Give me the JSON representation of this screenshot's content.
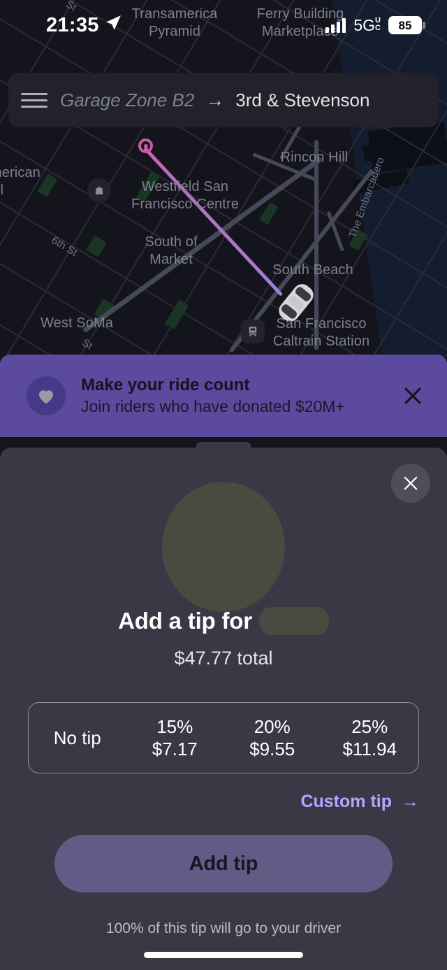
{
  "status_bar": {
    "time": "21:35",
    "location_arrow_icon": "navigation-arrow-icon",
    "signal_icon": "cellular-bars-icon",
    "network": "5G",
    "network_sup_top": "U",
    "network_sup_bottom": "C",
    "battery_level": "85"
  },
  "top_bar": {
    "menu_icon": "hamburger-menu-icon",
    "from": "Garage Zone B2",
    "arrow": "→",
    "to": "3rd & Stevenson"
  },
  "map": {
    "labels": [
      {
        "text": "Transamerica\nPyramid"
      },
      {
        "text": "Ferry Building\nMarketplace"
      },
      {
        "text": "Rincon Hill"
      },
      {
        "text": "Westfield San\nFrancisco Centre"
      },
      {
        "text": "South of\nMarket"
      },
      {
        "text": "South Beach"
      },
      {
        "text": "West SoMa"
      },
      {
        "text": "San Francisco\nCaltrain Station"
      },
      {
        "text": "The Embarcadero"
      },
      {
        "text": "6th St"
      },
      {
        "text": "merican"
      },
      {
        "text": "ll"
      },
      {
        "text": "St"
      },
      {
        "text": "St"
      }
    ],
    "origin_marker": "origin-pin-icon",
    "vehicle_marker": "car-marker-icon",
    "shopping_poi": "shopping-bag-icon",
    "transit_poi": "train-station-icon",
    "route_color": "#c766b0"
  },
  "banner": {
    "icon": "heart-icon",
    "title": "Make your ride count",
    "subtitle": "Join riders who have donated $20M+",
    "close_icon": "close-icon",
    "background": "#5b4a9e"
  },
  "tip_sheet": {
    "close_icon": "close-icon",
    "avatar": "driver-avatar-redacted",
    "title": "Add a tip for",
    "driver_name_redacted": "",
    "total": "$47.77 total",
    "options": [
      {
        "percent": "No tip",
        "amount": ""
      },
      {
        "percent": "15%",
        "amount": "$7.17"
      },
      {
        "percent": "20%",
        "amount": "$9.55"
      },
      {
        "percent": "25%",
        "amount": "$11.94"
      }
    ],
    "custom_tip_label": "Custom tip",
    "custom_tip_arrow": "→",
    "cta_label": "Add tip",
    "footnote": "100% of this tip will go to your driver",
    "accent_color": "#b9a3ff",
    "cta_color": "#625b86"
  }
}
